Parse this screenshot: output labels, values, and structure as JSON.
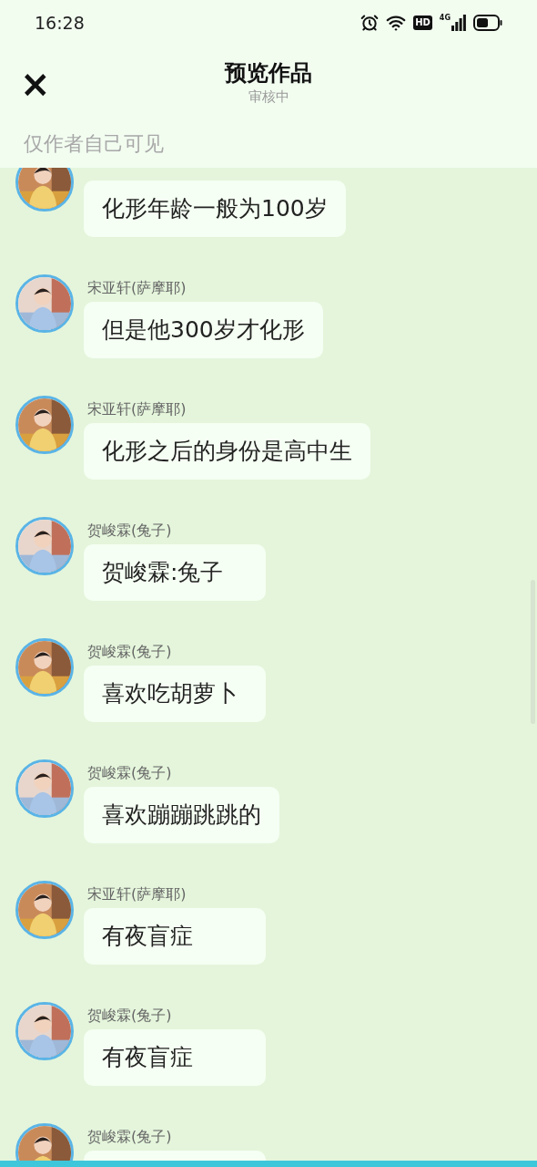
{
  "status_bar": {
    "time": "16:28",
    "hd_label": "HD",
    "network_label": "4G"
  },
  "header": {
    "close_icon": "×",
    "title": "预览作品",
    "subtitle": "审核中"
  },
  "notice": "仅作者自己可见",
  "messages": [
    {
      "text": "化形年龄一般为100岁"
    },
    {
      "sender": "宋亚轩(萨摩耶)",
      "text": "但是他300岁才化形"
    },
    {
      "sender": "宋亚轩(萨摩耶)",
      "text": "化形之后的身份是高中生"
    },
    {
      "sender": "贺峻霖(兔子)",
      "text": "贺峻霖:兔子"
    },
    {
      "sender": "贺峻霖(兔子)",
      "text": "喜欢吃胡萝卜"
    },
    {
      "sender": "贺峻霖(兔子)",
      "text": "喜欢蹦蹦跳跳的"
    },
    {
      "sender": "宋亚轩(萨摩耶)",
      "text": "有夜盲症"
    },
    {
      "sender": "贺峻霖(兔子)",
      "text": "有夜盲症"
    },
    {
      "sender": "贺峻霖(兔子)"
    }
  ]
}
